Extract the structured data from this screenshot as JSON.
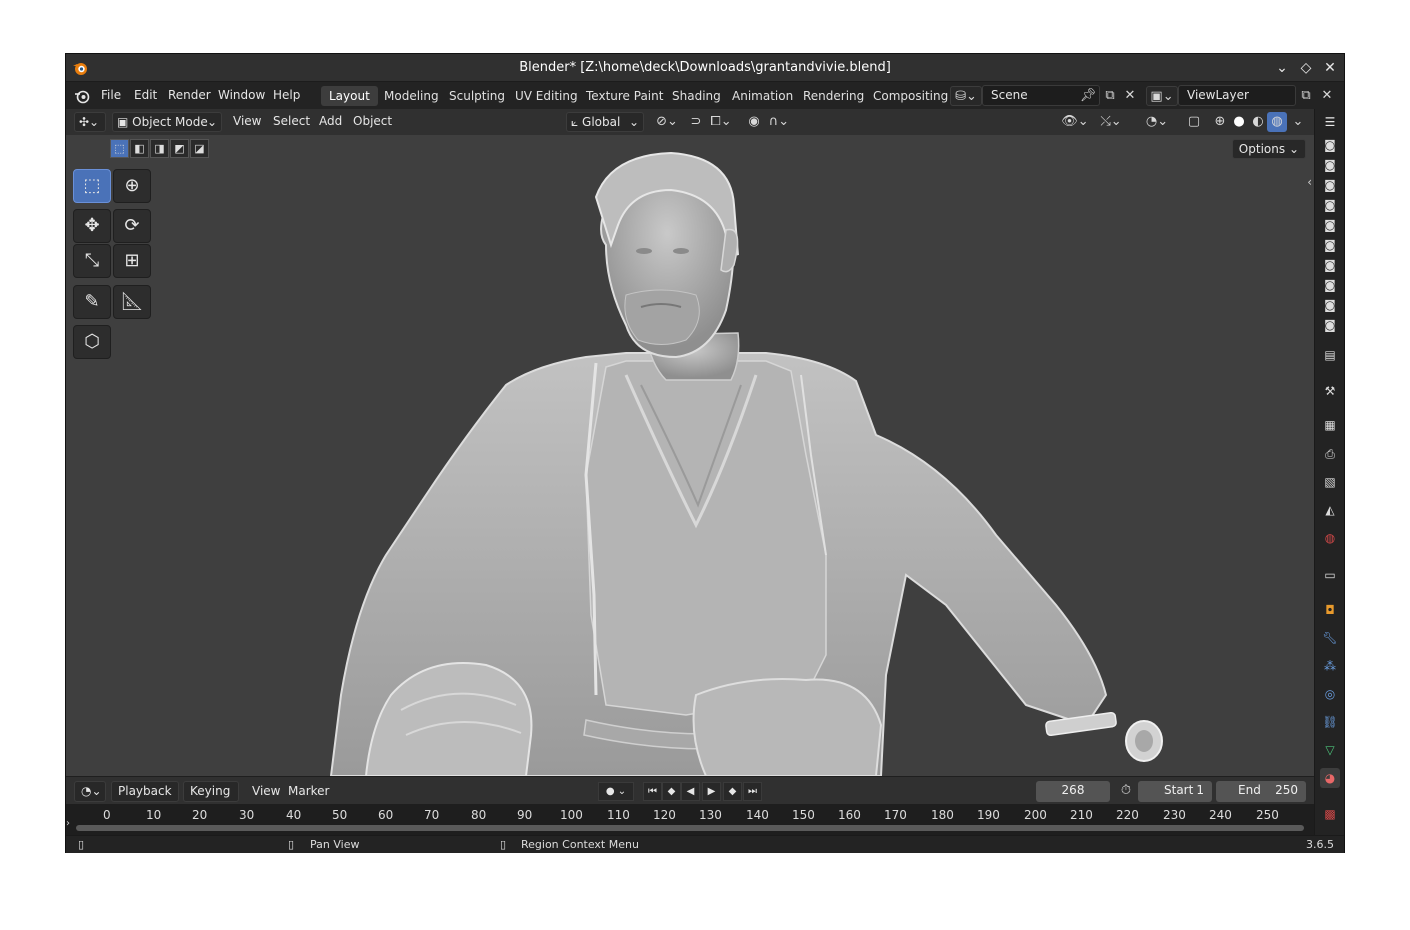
{
  "window": {
    "title": "Blender* [Z:\\home\\deck\\Downloads\\grantandvivie.blend]",
    "controls": [
      "chevron-down-icon",
      "diamond-icon",
      "close-icon"
    ]
  },
  "menubar": {
    "menus": [
      "File",
      "Edit",
      "Render",
      "Window",
      "Help"
    ],
    "workspaces": [
      "Layout",
      "Modeling",
      "Sculpting",
      "UV Editing",
      "Texture Paint",
      "Shading",
      "Animation",
      "Rendering",
      "Compositing"
    ],
    "active_workspace": "Layout",
    "scene": "Scene",
    "view_layer": "ViewLayer"
  },
  "header3d": {
    "mode": "Object Mode",
    "menus": [
      "View",
      "Select",
      "Add",
      "Object"
    ],
    "transform_orientation": "Global"
  },
  "viewport": {
    "options_label": "Options"
  },
  "timeline": {
    "menus": [
      "Playback",
      "Keying",
      "View",
      "Marker"
    ],
    "current_frame": "268",
    "start_label": "Start",
    "start_value": "1",
    "end_label": "End",
    "end_value": "250",
    "ticks": [
      "0",
      "10",
      "20",
      "30",
      "40",
      "50",
      "60",
      "70",
      "80",
      "90",
      "100",
      "110",
      "120",
      "130",
      "140",
      "150",
      "160",
      "170",
      "180",
      "190",
      "200",
      "210",
      "220",
      "230",
      "240",
      "250"
    ]
  },
  "statusbar": {
    "pan_view": "Pan View",
    "region_context_menu": "Region Context Menu",
    "version": "3.6.5"
  },
  "colors": {
    "accent": "#4a72b8",
    "viewport_bg": "#3f3f3f",
    "header_bg": "#303030"
  }
}
